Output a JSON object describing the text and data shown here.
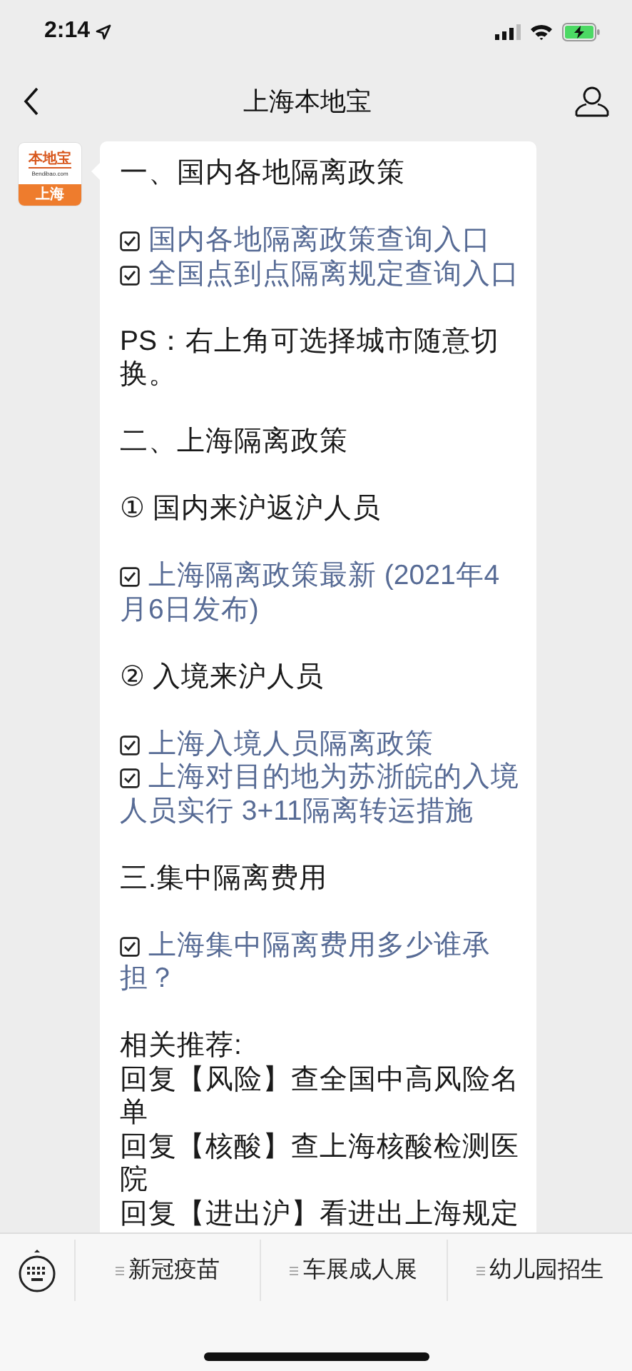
{
  "status_bar": {
    "time": "2:14"
  },
  "nav_bar": {
    "title": "上海本地宝"
  },
  "avatar": {
    "brand": "本地宝",
    "domain": "Bendibao.com",
    "city": "上海"
  },
  "message": {
    "blocks": [
      [
        {
          "kind": "text",
          "text": "一、国内各地隔离政策"
        }
      ],
      [
        {
          "kind": "link",
          "text": "国内各地隔离政策查询入口"
        },
        {
          "kind": "link",
          "text": "全国点到点隔离规定查询入口"
        }
      ],
      [
        {
          "kind": "text",
          "text": "PS：右上角可选择城市随意切换。"
        }
      ],
      [
        {
          "kind": "text",
          "text": "二、上海隔离政策"
        }
      ],
      [
        {
          "kind": "text",
          "text": "① 国内来沪返沪人员"
        }
      ],
      [
        {
          "kind": "link",
          "text": "上海隔离政策最新 (2021年4月6日发布)"
        }
      ],
      [
        {
          "kind": "text",
          "text": "② 入境来沪人员"
        }
      ],
      [
        {
          "kind": "link",
          "text": "上海入境人员隔离政策"
        },
        {
          "kind": "link",
          "text": "上海对目的地为苏浙皖的入境人员实行 3+11隔离转运措施"
        }
      ],
      [
        {
          "kind": "text",
          "text": "三.集中隔离费用"
        }
      ],
      [
        {
          "kind": "link",
          "text": "上海集中隔离费用多少谁承担？"
        }
      ],
      [
        {
          "kind": "text",
          "text": "相关推荐:"
        },
        {
          "kind": "text",
          "text": "回复【风险】查全国中高风险名单"
        },
        {
          "kind": "text",
          "text": "回复【核酸】查上海核酸检测医院"
        },
        {
          "kind": "text",
          "text": "回复【进出沪】看进出上海规定"
        }
      ]
    ]
  },
  "bottom_menu": {
    "items": [
      {
        "label": "新冠疫苗"
      },
      {
        "label": "车展成人展"
      },
      {
        "label": "幼儿园招生"
      }
    ]
  }
}
